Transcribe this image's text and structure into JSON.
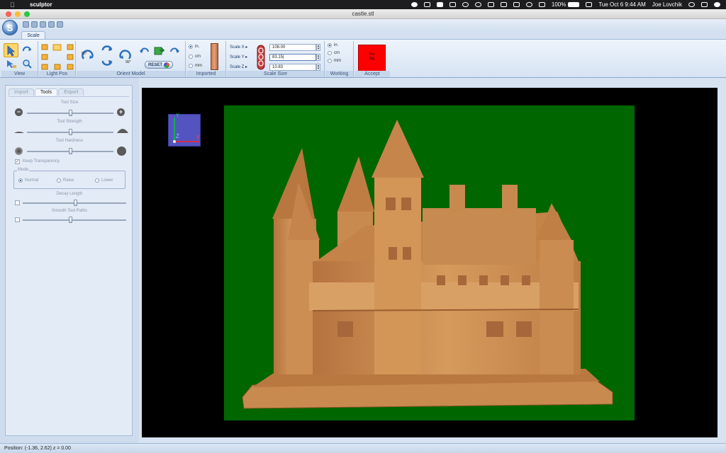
{
  "menubar": {
    "app_name": "sculptor",
    "battery": "100%",
    "clock": "Tue Oct 6  9:44 AM",
    "user": "Joe Lovchik"
  },
  "window": {
    "title": "castle.stl"
  },
  "ribbon": {
    "tab": "Scale",
    "groups": {
      "view": "View",
      "light_pos": "Light Pos",
      "orient_model": "Orient Model",
      "imported": "Imported",
      "scale_size": "Scale  Size",
      "working": "Working",
      "accept": "Accept"
    },
    "reset_label": "RESET",
    "units_imported": [
      "in.",
      "cm",
      "mm"
    ],
    "units_working": [
      "in.",
      "cm",
      "mm"
    ],
    "scale": {
      "x_label": "Scale X ▸",
      "y_label": "Scale Y ▸",
      "z_label": "Scale Z ▸",
      "x_value": "108.00",
      "y_value": "83.15|",
      "z_value": "10.83"
    },
    "accept_text_line1": "Too",
    "accept_text_line2": "Big"
  },
  "panel": {
    "tabs": [
      "Import",
      "Tools",
      "Export"
    ],
    "active_tab": "Tools",
    "tool_size_label": "Tool Size",
    "tool_strength_label": "Tool Strength",
    "tool_hardness_label": "Tool Hardness",
    "keep_transparency_label": "Keep Transparency",
    "mode_label": "Mode",
    "mode_options": [
      "Normal",
      "Raise",
      "Lower"
    ],
    "mode_selected": "Normal",
    "decay_length_label": "Decay Length",
    "smooth_tool_paths_label": "Smooth Tool Paths",
    "slider_levels": {
      "tool_size": 0.5,
      "tool_strength": 0.5,
      "tool_hardness": 0.5,
      "decay_length": 0.5,
      "smooth_tool_paths": 0.45
    }
  },
  "viewport": {
    "axis_labels": {
      "y": "Y",
      "z": "Z",
      "x": "X"
    },
    "colors": {
      "background": "#000000",
      "plate": "#006600",
      "model": "#c98a4f",
      "axis_box": "#5454c0"
    }
  },
  "status": {
    "position": "Position: (-1.36, 2.62) z = 0.00"
  }
}
